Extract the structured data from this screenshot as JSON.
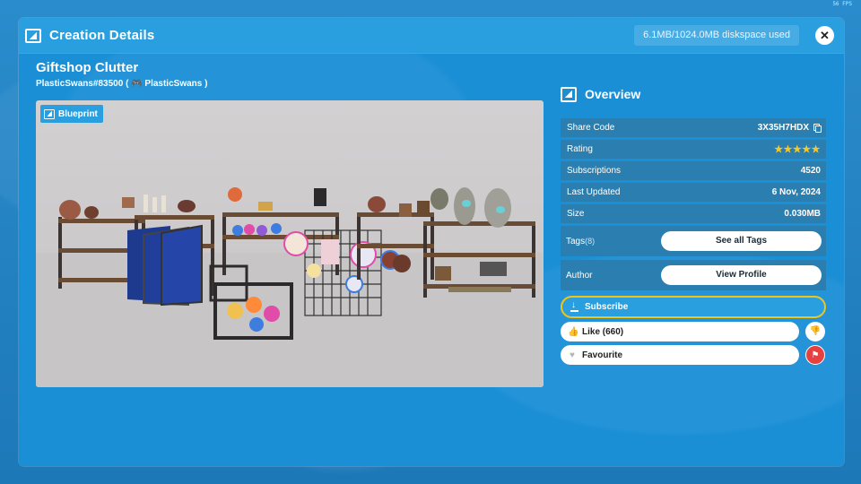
{
  "fps": "56 FPS",
  "header": {
    "title": "Creation Details",
    "disk_usage": "6.1MB/1024.0MB diskspace used",
    "close_label": "✕"
  },
  "creation": {
    "title": "Giftshop Clutter",
    "author_line": "PlasticSwans#83500 ( 🎮 PlasticSwans )",
    "preview_tag": "Blueprint"
  },
  "overview": {
    "title": "Overview",
    "rows": [
      {
        "label": "Share Code",
        "value": "3X35H7HDX"
      },
      {
        "label": "Rating",
        "value": "★★★★★"
      },
      {
        "label": "Subscriptions",
        "value": "4520"
      },
      {
        "label": "Last Updated",
        "value": "6 Nov, 2024"
      },
      {
        "label": "Size",
        "value": "0.030MB"
      }
    ],
    "tags": {
      "label": "Tags",
      "count": "(8)",
      "button": "See all Tags"
    },
    "author": {
      "label": "Author",
      "button": "View Profile"
    }
  },
  "actions": {
    "subscribe": "Subscribe",
    "like": "Like (660)",
    "favourite": "Favourite"
  },
  "colors": {
    "accent": "#2a9fe0",
    "highlight": "#f0c419",
    "danger": "#e64040",
    "star": "#f6c62a"
  }
}
